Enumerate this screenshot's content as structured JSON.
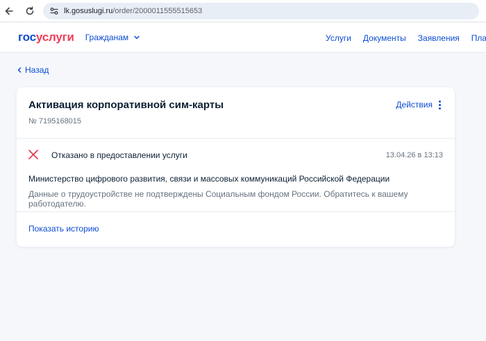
{
  "browser": {
    "url_domain": "lk.gosuslugi.ru",
    "url_path": "/order/2000011555515653"
  },
  "header": {
    "logo_part1": "гос",
    "logo_part2": "услуги",
    "audience": "Гражданам",
    "nav": [
      "Услуги",
      "Документы",
      "Заявления",
      "Платежи"
    ]
  },
  "back_label": "Назад",
  "order": {
    "title": "Активация корпоративной сим-карты",
    "number": "№ 7195168015",
    "actions_label": "Действия",
    "status": "Отказано в предоставлении услуги",
    "status_date": "13.04.26 в 13:13",
    "ministry": "Министерство цифрового развития, связи и массовых коммуникаций Российской Федерации",
    "reason": "Данные о трудоустройстве не подтверждены Социальным фондом России. Обратитесь к вашему работодателю.",
    "history_link": "Показать историю"
  },
  "colors": {
    "brand_blue": "#0d4cd3",
    "brand_red": "#ee3f58",
    "status_rejected": "#e0344c"
  },
  "icons": {
    "back": "arrow-left-icon",
    "reload": "reload-icon",
    "site_info": "site-settings-icon",
    "chevron": "chevron-down-icon",
    "back_chevron": "chevron-left-icon",
    "actions": "kebab-icon",
    "status": "cross-icon"
  }
}
